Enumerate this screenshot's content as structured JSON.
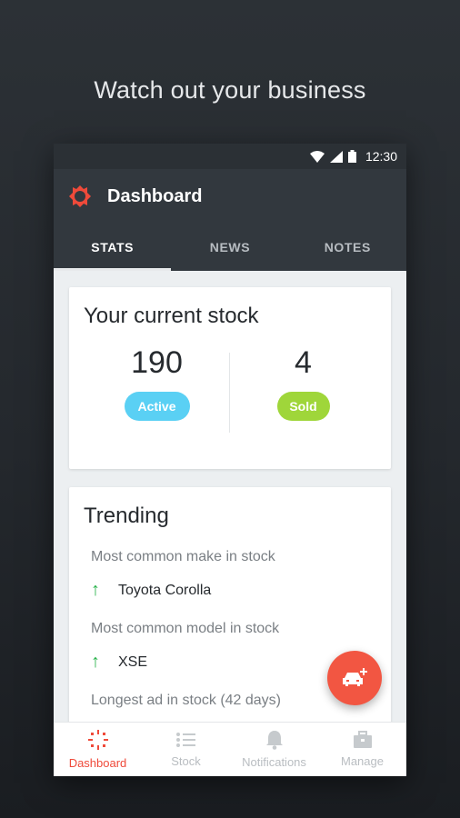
{
  "headline": "Watch out your business",
  "status_bar": {
    "time": "12:30",
    "icons": [
      "wifi-icon",
      "signal-icon",
      "battery-icon"
    ]
  },
  "app_bar": {
    "title": "Dashboard",
    "logo": "red-gear-logo"
  },
  "tabs": [
    {
      "label": "STATS",
      "active": true
    },
    {
      "label": "NEWS",
      "active": false
    },
    {
      "label": "NOTES",
      "active": false
    }
  ],
  "stock_card": {
    "title": "Your current stock",
    "active": {
      "count": "190",
      "label": "Active"
    },
    "sold": {
      "count": "4",
      "label": "Sold"
    }
  },
  "trending": {
    "title": "Trending",
    "items": [
      {
        "label": "Most common make in stock",
        "value": "Toyota Corolla"
      },
      {
        "label": "Most common model in stock",
        "value": "XSE"
      },
      {
        "label": "Longest ad in stock  (42 days)"
      }
    ]
  },
  "fab": {
    "icon": "add-car-icon"
  },
  "bottom_nav": [
    {
      "label": "Dashboard",
      "icon": "dashboard-icon",
      "active": true
    },
    {
      "label": "Stock",
      "icon": "list-icon",
      "active": false
    },
    {
      "label": "Notifications",
      "icon": "bell-icon",
      "active": false
    },
    {
      "label": "Manage",
      "icon": "briefcase-icon",
      "active": false
    }
  ],
  "colors": {
    "accent": "#f25642",
    "active_pill": "#5ad0f4",
    "sold_pill": "#9fd63a",
    "appbar": "#32383e",
    "trend_up": "#27b24a"
  }
}
